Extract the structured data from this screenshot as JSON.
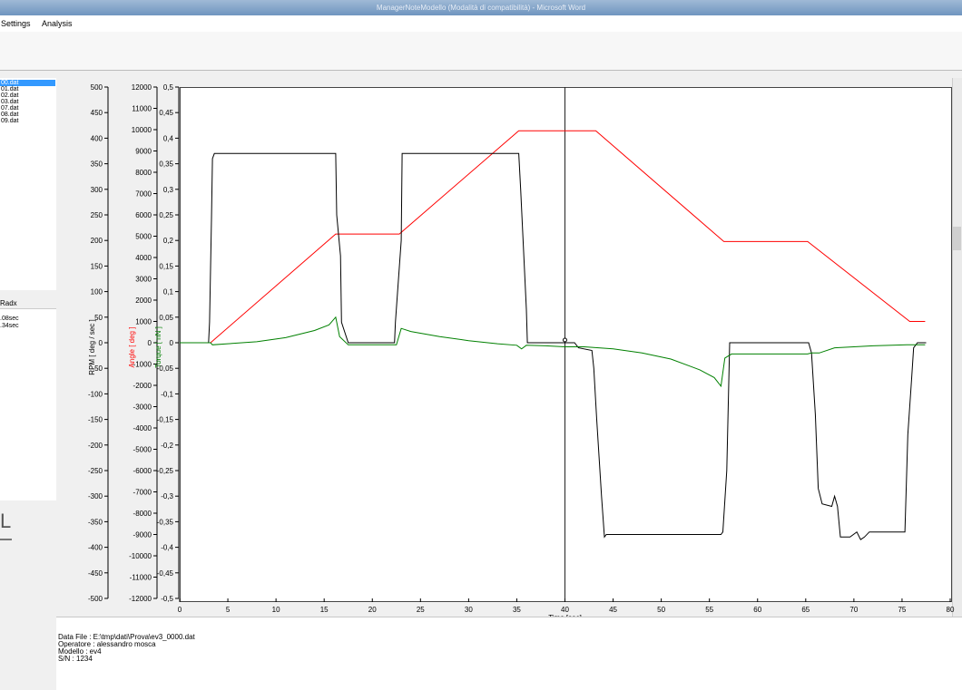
{
  "window": {
    "title": "ManagerNoteModello (Modalità di compatibilità) - Microsoft Word"
  },
  "menu": {
    "settings": "Settings",
    "analysis": "Analysis"
  },
  "sidebar": {
    "files": [
      "00.dat",
      "01.dat",
      "02.dat",
      "03.dat",
      "07.dat",
      "08.dat",
      "09.dat"
    ],
    "radx_header": "Radx",
    "radx_items": [
      ".08sec",
      ".34sec"
    ]
  },
  "info": {
    "data_file": "Data File : E:\\tmp\\dati\\Prova\\ev3_0000.dat",
    "operatore": "Operatore : alessandro mosca",
    "modello": "Modello : ev4",
    "sn": "S/N : 1234"
  },
  "colors": {
    "angle": "#ff0000",
    "torque": "#008000",
    "rpm": "#000000",
    "cursor": "#222222"
  },
  "chart_data": {
    "type": "line",
    "xlabel": "Time [sec]",
    "xlim": [
      0,
      80
    ],
    "xticks": [
      0,
      5,
      10,
      15,
      20,
      25,
      30,
      35,
      40,
      45,
      50,
      55,
      60,
      65,
      70,
      75,
      80
    ],
    "cursor_x": 40,
    "axes": [
      {
        "label": "RPM [ deg / sec ]",
        "color": "#000000",
        "lim": [
          -500,
          500
        ],
        "ticks": [
          500,
          450,
          400,
          350,
          300,
          250,
          200,
          150,
          100,
          50,
          0,
          -50,
          -100,
          -150,
          -200,
          -250,
          -300,
          -350,
          -400,
          -450,
          -500
        ],
        "tick_labels": [
          "500",
          "450",
          "400",
          "350",
          "300",
          "250",
          "200",
          "150",
          "100",
          "50",
          "0",
          "-50",
          "-100",
          "-150",
          "-200",
          "-250",
          "-300",
          "-350",
          "-400",
          "-450",
          "-500"
        ]
      },
      {
        "label": "Angle [ deg ]",
        "color": "#ff0000",
        "lim": [
          -12000,
          12000
        ],
        "ticks": [
          12000,
          11000,
          10000,
          9000,
          8000,
          7000,
          6000,
          5000,
          4000,
          3000,
          2000,
          1000,
          0,
          -1000,
          -2000,
          -3000,
          -4000,
          -5000,
          -6000,
          -7000,
          -8000,
          -9000,
          -10000,
          -11000,
          -12000
        ],
        "tick_labels": [
          "12000",
          "11000",
          "10000",
          "9000",
          "8000",
          "7000",
          "6000",
          "5000",
          "4000",
          "3000",
          "2000",
          "1000",
          "0",
          "-1000",
          "-2000",
          "-3000",
          "-4000",
          "-5000",
          "-6000",
          "-7000",
          "-8000",
          "-9000",
          "-10000",
          "-11000",
          "-12000"
        ]
      },
      {
        "label": "Torque [ nN ]",
        "color": "#008000",
        "lim": [
          -0.5,
          0.5
        ],
        "ticks": [
          0.5,
          0.45,
          0.4,
          0.35,
          0.3,
          0.25,
          0.2,
          0.15,
          0.1,
          0.05,
          0,
          -0.05,
          -0.1,
          -0.15,
          -0.2,
          -0.25,
          -0.3,
          -0.35,
          -0.4,
          -0.45,
          -0.5
        ],
        "tick_labels": [
          "0,5",
          "0,45",
          "0,4",
          "0,35",
          "0,3",
          "0,25",
          "0,2",
          "0,15",
          "0,1",
          "0,05",
          "0",
          "-0,05",
          "-0,1",
          "-0,15",
          "-0,2",
          "-0,25",
          "-0,3",
          "-0,35",
          "-0,4",
          "-0,45",
          "-0,5"
        ]
      }
    ],
    "series": [
      {
        "axis": 1,
        "color": "#ff0000",
        "x": [
          0,
          3.2,
          16.2,
          22.8,
          35.2,
          43.2,
          56.5,
          65.2,
          75.8,
          77.4
        ],
        "y": [
          0,
          0,
          5100,
          5100,
          9950,
          9950,
          4750,
          4750,
          1000,
          1000
        ]
      },
      {
        "axis": 0,
        "color": "#000000",
        "x": [
          0,
          3.0,
          3.1,
          3.3,
          3.4,
          3.6,
          16.2,
          16.3,
          16.7,
          16.8,
          17.5,
          22.3,
          22.4,
          23.0,
          23.1,
          23.3,
          35.2,
          35.4,
          36.0,
          36.1,
          39.9,
          40.0,
          41.0,
          41.4,
          42.8,
          43.0,
          43.3,
          43.8,
          44.1,
          44.3,
          56.2,
          56.4,
          56.8,
          57.1,
          65.3,
          65.6,
          66.0,
          66.3,
          66.7,
          67.7,
          68.0,
          68.3,
          68.6,
          69.6,
          70.3,
          70.7,
          71.1,
          71.6,
          75.3,
          75.6,
          76.0,
          76.2,
          76.6,
          77.5
        ],
        "y": [
          0,
          0,
          40,
          240,
          360,
          370,
          370,
          250,
          170,
          40,
          0,
          0,
          40,
          200,
          370,
          370,
          370,
          300,
          65,
          0,
          0,
          0,
          0,
          -10,
          -15,
          -50,
          -150,
          -300,
          -380,
          -375,
          -375,
          -370,
          -250,
          0,
          0,
          -20,
          -140,
          -285,
          -315,
          -320,
          -300,
          -320,
          -380,
          -380,
          -370,
          -385,
          -380,
          -370,
          -370,
          -180,
          -70,
          -10,
          0,
          0
        ]
      },
      {
        "axis": 2,
        "color": "#008000",
        "x": [
          0,
          3.2,
          3.4,
          5,
          8,
          11,
          14,
          15.5,
          16.2,
          16.6,
          17.5,
          22.5,
          23.0,
          24,
          27,
          30,
          33,
          35,
          35.5,
          36,
          38,
          40,
          42,
          45,
          48,
          51,
          54,
          55.5,
          56.2,
          56.6,
          57.3,
          65.2,
          65.6,
          66.4,
          68,
          70,
          72,
          74,
          75.5,
          77.4
        ],
        "y": [
          0,
          0,
          -0.004,
          -0.002,
          0.002,
          0.01,
          0.024,
          0.035,
          0.05,
          0.012,
          -0.004,
          -0.004,
          0.028,
          0.022,
          0.012,
          0.004,
          -0.002,
          -0.005,
          -0.012,
          -0.005,
          -0.006,
          -0.008,
          -0.008,
          -0.012,
          -0.02,
          -0.032,
          -0.053,
          -0.068,
          -0.085,
          -0.03,
          -0.022,
          -0.022,
          -0.02,
          -0.02,
          -0.01,
          -0.008,
          -0.006,
          -0.005,
          -0.004,
          -0.004
        ]
      }
    ]
  }
}
